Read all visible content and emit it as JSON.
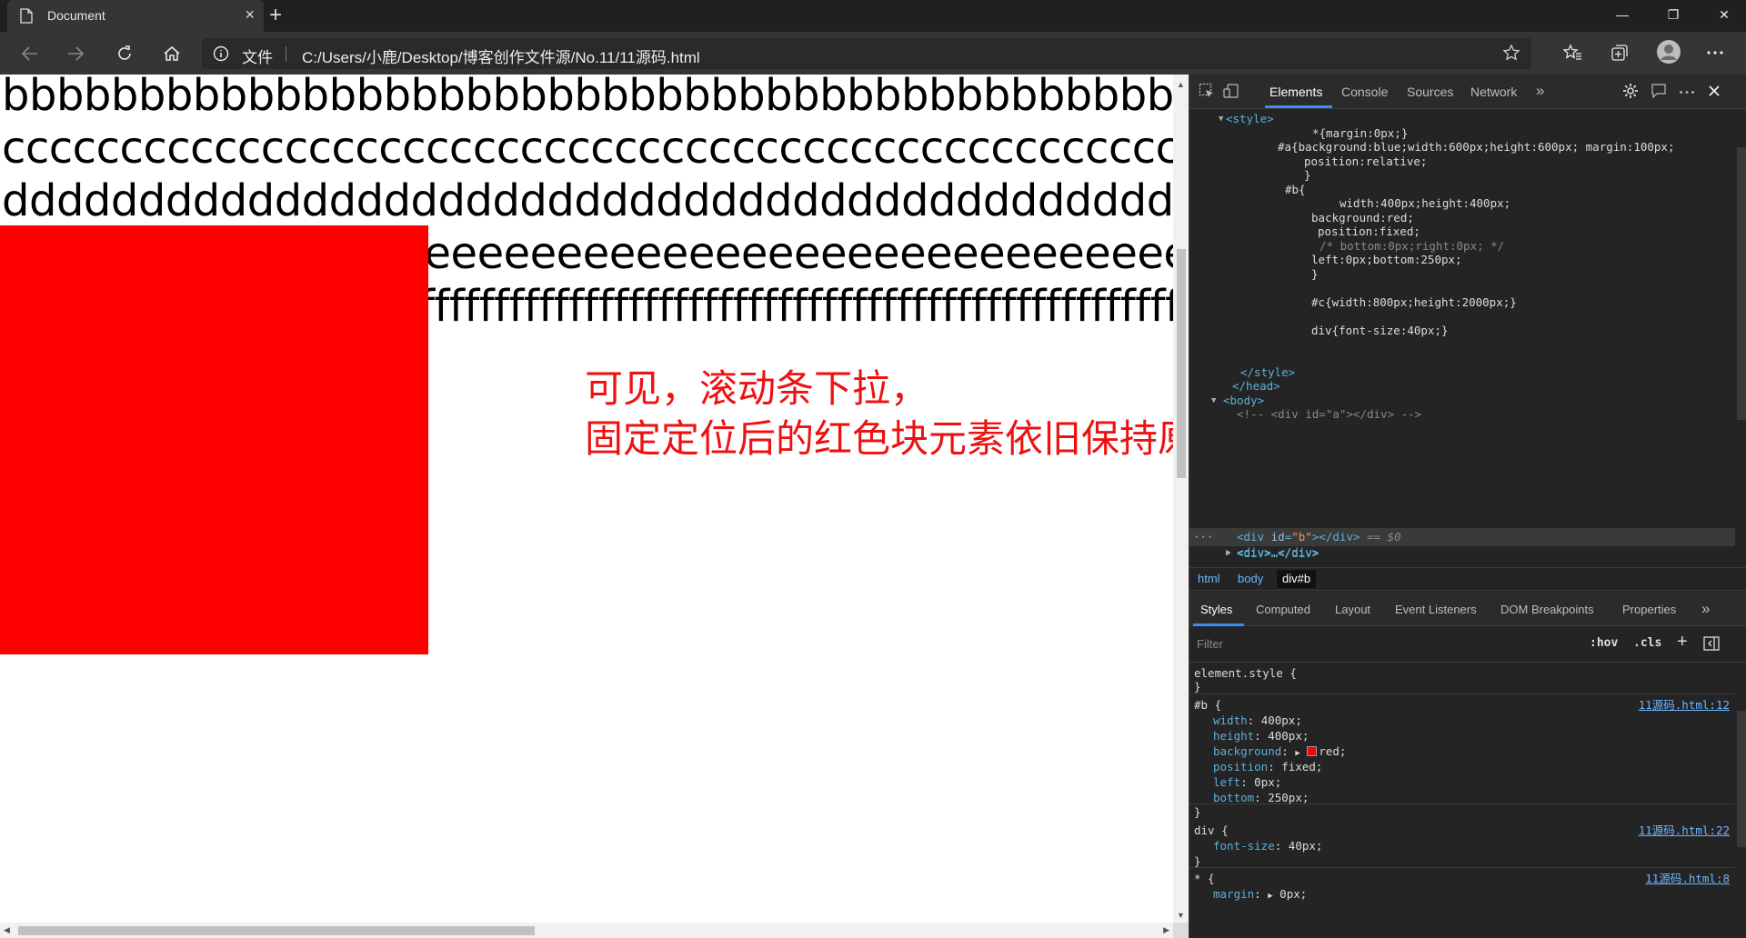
{
  "browser": {
    "tab_title": "Document",
    "tab_close": "×",
    "new_tab": "+",
    "window_controls": [
      "—",
      "❐",
      "✕"
    ],
    "address_label": "文件",
    "url": "C:/Users/小鹿/Desktop/博客创作文件源/No.11/11源码.html"
  },
  "page": {
    "lines": [
      "bbbbbbbbbbbbbbbbbbbbbbbbbbbbbbbbbbbbbbbbbbbbbbbbbbbbbbbbbb",
      "cccccccccccccccccccccccccccccccccccccccccccccccccccccccccccc",
      "dddddddddddddddddddddddddddddddddddddddddddddddddddddddddd",
      "eeeeeeeeeeeeeeeeeeeeeeeeeeeeeeeeeeeeeeeeeeeeeeeeeeeeeeeeeeee",
      "ffffffffffffffffffffffffffffffffffffffffffffffffffffffffffffffffffffffffffffffffffff"
    ],
    "note_line1": "可见，滚动条下拉，",
    "note_line2": "固定定位后的红色块元素依旧保持原来的位置。",
    "red_box_color": "#ff0000"
  },
  "devtools": {
    "tabs": [
      "Elements",
      "Console",
      "Sources",
      "Network"
    ],
    "more": "»",
    "code": {
      "style_open": "<style>",
      "l1": "*{margin:0px;}",
      "l2": "#a{background:blue;width:600px;height:600px; margin:100px;",
      "l3": "position:relative;",
      "l4": "}",
      "l5": "#b{",
      "l6": "width:400px;height:400px;",
      "l7": "background:red;",
      "l8": "position:fixed;",
      "l9": "/* bottom:0px;right:0px; */",
      "l10": "left:0px;bottom:250px;",
      "l11": "}",
      "l12": "#c{width:800px;height:2000px;}",
      "l13": "div{font-size:40px;}",
      "style_close": "</style>",
      "head_close": "</head>",
      "body_open": "<body>",
      "comment": "<!-- <div id=\"a\"></div> -->",
      "selected_prefix": "<div ",
      "selected_attr": "id",
      "selected_eq": "=",
      "selected_val": "\"b\"",
      "selected_suffix": "></div>",
      "selected_marker": " == $0",
      "div_collapsed": "<div>…</div>",
      "dots": "···"
    },
    "breadcrumbs": [
      "html",
      "body",
      "div#b"
    ],
    "style_tabs": [
      "Styles",
      "Computed",
      "Layout",
      "Event Listeners",
      "DOM Breakpoints",
      "Properties"
    ],
    "filter_placeholder": "Filter",
    "hov": ":hov",
    "cls": ".cls",
    "add": "+",
    "rules": {
      "element_style": "element.style {",
      "close": "}",
      "b_selector": "#b {",
      "b_src": "11源码.html:12",
      "b_props": [
        {
          "name": "width",
          "value": "400px;"
        },
        {
          "name": "height",
          "value": "400px;"
        },
        {
          "name": "background",
          "value": "red;"
        },
        {
          "name": "position",
          "value": "fixed;"
        },
        {
          "name": "left",
          "value": "0px;"
        },
        {
          "name": "bottom",
          "value": "250px;"
        }
      ],
      "div_selector": "div {",
      "div_src": "11源码.html:22",
      "div_prop": {
        "name": "font-size",
        "value": "40px;"
      },
      "star_selector": "* {",
      "star_src": "11源码.html:8",
      "star_prop": {
        "name": "margin",
        "value": "0px;"
      }
    }
  }
}
